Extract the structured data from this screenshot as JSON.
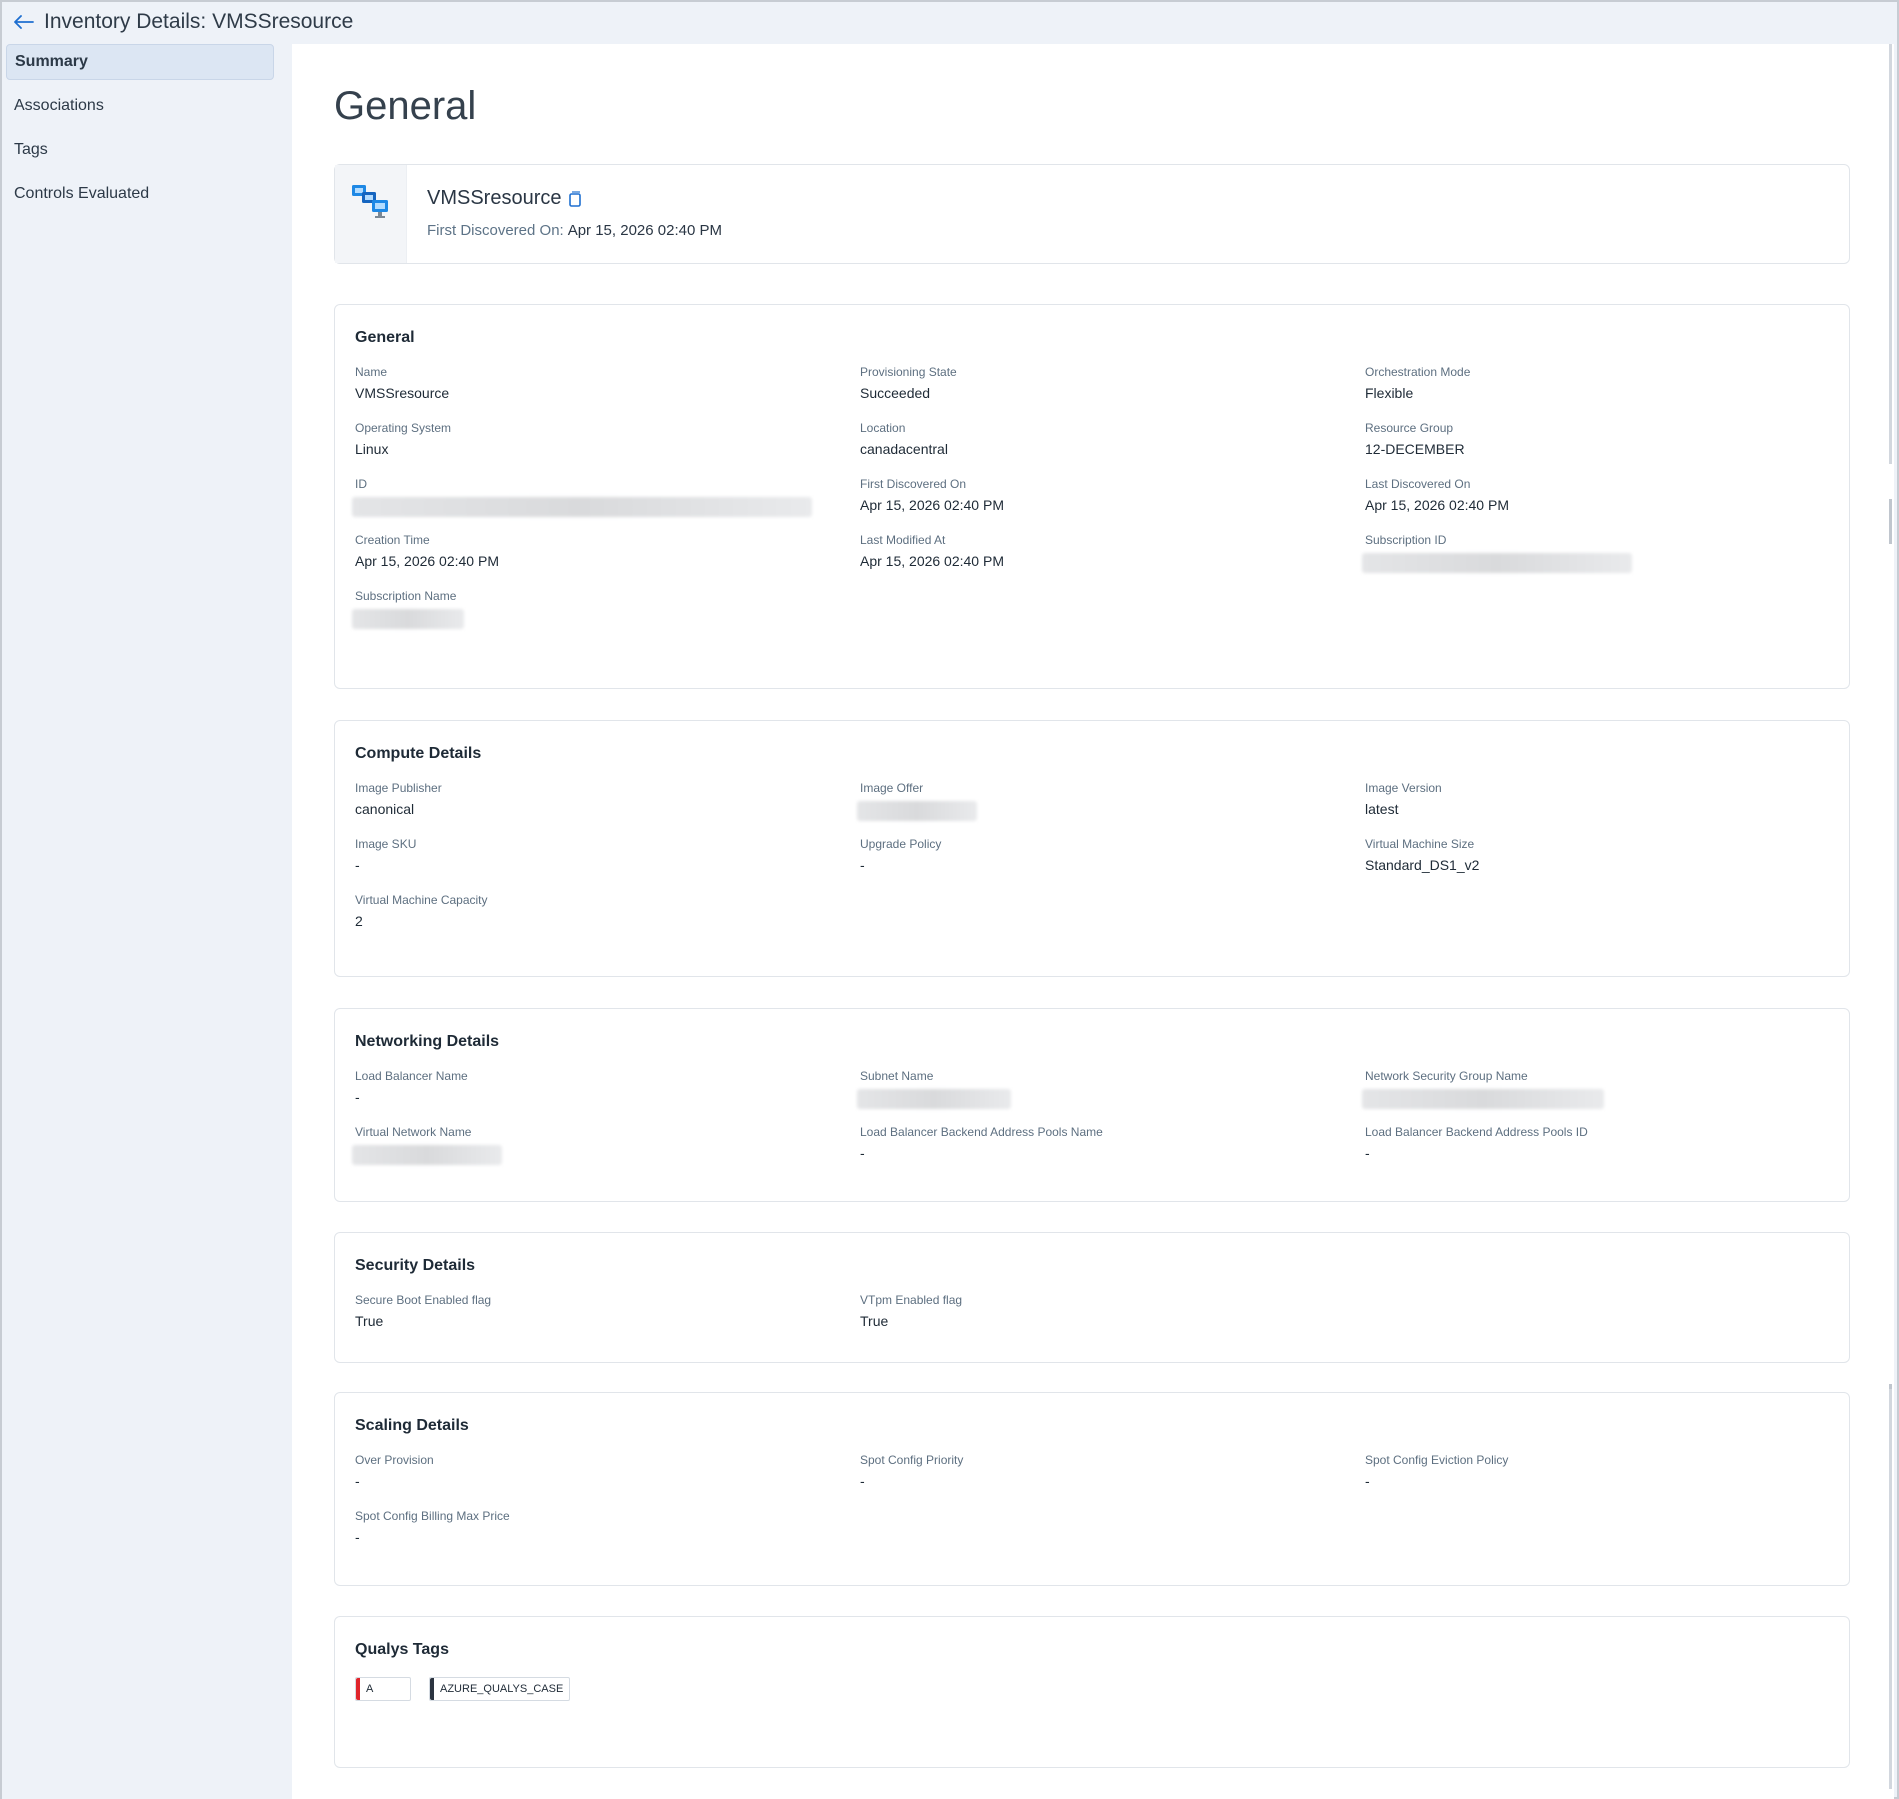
{
  "topbar": {
    "title": "Inventory Details: VMSSresource"
  },
  "sidebar": {
    "items": [
      {
        "label": "Summary"
      },
      {
        "label": "Associations"
      },
      {
        "label": "Tags"
      },
      {
        "label": "Controls Evaluated"
      }
    ]
  },
  "page": {
    "title": "General"
  },
  "header": {
    "resource_name": "VMSSresource",
    "first_discovered_label": "First Discovered On:",
    "first_discovered_value": "Apr 15, 2026 02:40 PM"
  },
  "general": {
    "title": "General",
    "fields": [
      {
        "label": "Name",
        "value": "VMSSresource"
      },
      {
        "label": "Provisioning State",
        "value": "Succeeded"
      },
      {
        "label": "Orchestration Mode",
        "value": "Flexible"
      },
      {
        "label": "Operating System",
        "value": "Linux"
      },
      {
        "label": "Location",
        "value": "canadacentral"
      },
      {
        "label": "Resource Group",
        "value": "12-DECEMBER"
      },
      {
        "label": "ID",
        "value": null
      },
      {
        "label": "First Discovered On",
        "value": "Apr 15, 2026 02:40 PM"
      },
      {
        "label": "Last Discovered On",
        "value": "Apr 15, 2026 02:40 PM"
      },
      {
        "label": "Creation Time",
        "value": "Apr 15, 2026 02:40 PM"
      },
      {
        "label": "Last Modified At",
        "value": "Apr 15, 2026 02:40 PM"
      },
      {
        "label": "Subscription ID",
        "value": null
      },
      {
        "label": "Subscription Name",
        "value": null
      }
    ]
  },
  "compute": {
    "title": "Compute Details",
    "fields": [
      {
        "label": "Image Publisher",
        "value": "canonical"
      },
      {
        "label": "Image Offer",
        "value": null
      },
      {
        "label": "Image Version",
        "value": "latest"
      },
      {
        "label": "Image SKU",
        "value": "-"
      },
      {
        "label": "Upgrade Policy",
        "value": "-"
      },
      {
        "label": "Virtual Machine Size",
        "value": "Standard_DS1_v2"
      },
      {
        "label": "Virtual Machine Capacity",
        "value": "2"
      }
    ]
  },
  "networking": {
    "title": "Networking Details",
    "fields": [
      {
        "label": "Load Balancer Name",
        "value": "-"
      },
      {
        "label": "Subnet Name",
        "value": null
      },
      {
        "label": "Network Security Group Name",
        "value": null
      },
      {
        "label": "Virtual Network Name",
        "value": null
      },
      {
        "label": "Load Balancer Backend Address Pools Name",
        "value": "-"
      },
      {
        "label": "Load Balancer Backend Address Pools ID",
        "value": "-"
      }
    ]
  },
  "security": {
    "title": "Security Details",
    "fields": [
      {
        "label": "Secure Boot Enabled flag",
        "value": "True"
      },
      {
        "label": "VTpm Enabled flag",
        "value": "True"
      }
    ]
  },
  "scaling": {
    "title": "Scaling Details",
    "fields": [
      {
        "label": "Over Provision",
        "value": "-"
      },
      {
        "label": "Spot Config Priority",
        "value": "-"
      },
      {
        "label": "Spot Config Eviction Policy",
        "value": "-"
      },
      {
        "label": "Spot Config Billing Max Price",
        "value": "-"
      }
    ]
  },
  "qualys_tags": {
    "title": "Qualys Tags",
    "tags": [
      {
        "label": "A",
        "color": "#e0242b"
      },
      {
        "label": "AZURE_QUALYS_CASE",
        "color": "#2b3440"
      }
    ]
  },
  "icons": {
    "back": "arrow-left-icon",
    "copy": "copy-icon",
    "resource": "vmss-icon"
  },
  "colors": {
    "sidebar_bg": "#eef2f8",
    "active_item_bg": "#dce6f3",
    "accent": "#1e6fd0"
  }
}
